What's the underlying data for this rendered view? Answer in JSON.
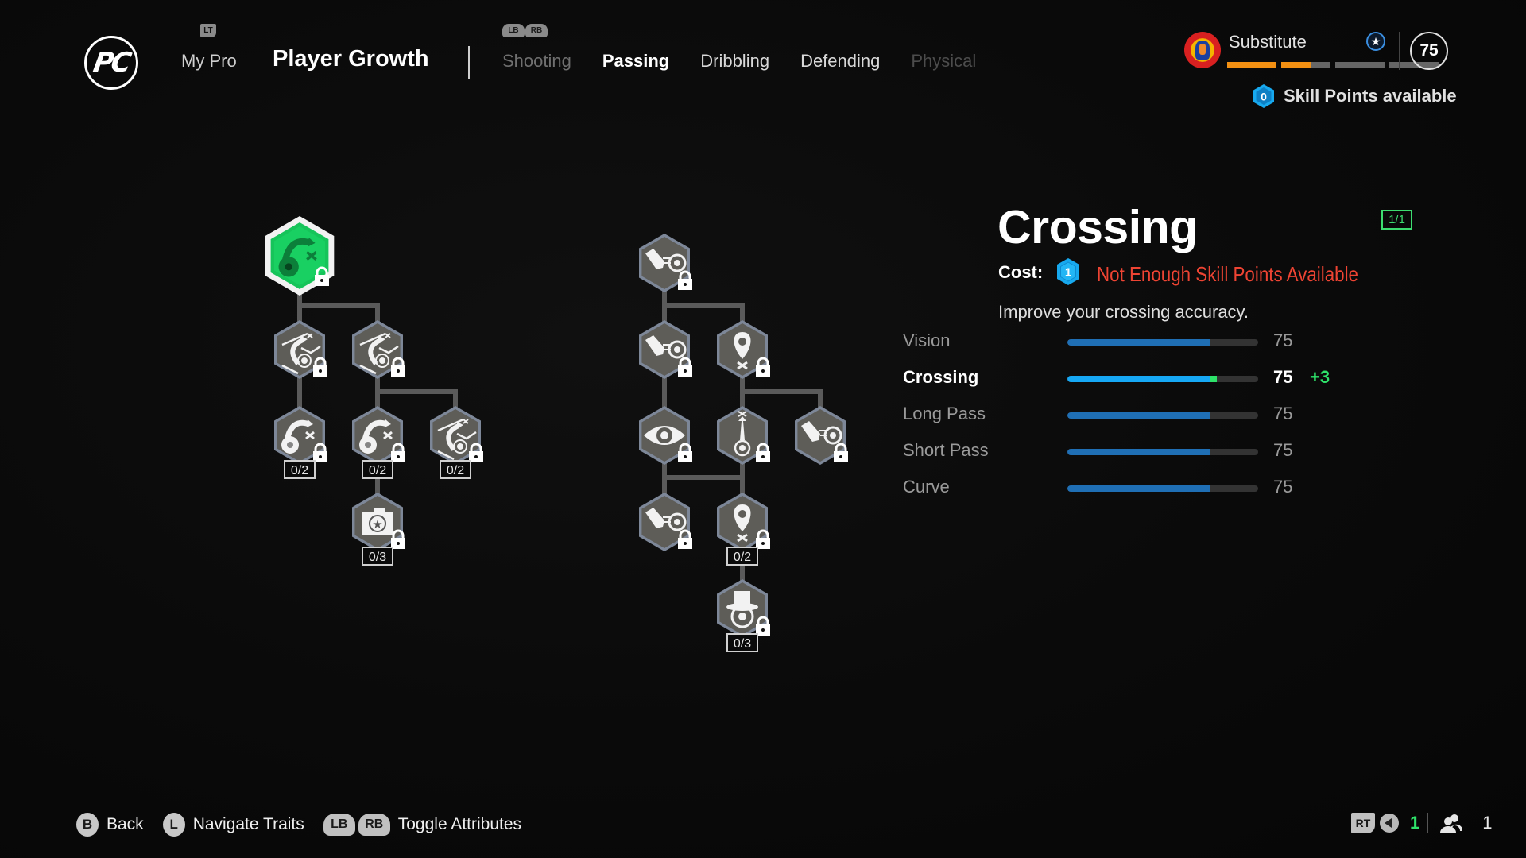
{
  "header": {
    "logo_text": "PC",
    "back_trigger": "LT",
    "my_pro_label": "My Pro",
    "title": "Player Growth",
    "tab_bumpers": [
      "LB",
      "RB"
    ],
    "tabs": [
      {
        "label": "Shooting",
        "state": "inactive"
      },
      {
        "label": "Passing",
        "state": "active"
      },
      {
        "label": "Dribbling",
        "state": "inactive"
      },
      {
        "label": "Defending",
        "state": "inactive"
      },
      {
        "label": "Physical",
        "state": "disabled"
      }
    ]
  },
  "player": {
    "club_crest": "East Bengal FC crest",
    "status": "Substitute",
    "status_icon": "star-icon",
    "form_segments": [
      1.0,
      0.6,
      0.0,
      0.0
    ],
    "overall_rating": "75",
    "skill_points": "0",
    "skill_points_label": "Skill Points available"
  },
  "tree": {
    "left": [
      {
        "id": "L1",
        "icon": "cross-ball-icon",
        "state": "selected",
        "count": null
      },
      {
        "id": "L2a",
        "icon": "cross-from-wing-icon",
        "state": "locked",
        "count": null
      },
      {
        "id": "L2b",
        "icon": "cross-from-wing-icon",
        "state": "locked",
        "count": null
      },
      {
        "id": "L3a",
        "icon": "cross-ball-icon",
        "state": "locked",
        "count": "0/2"
      },
      {
        "id": "L3b",
        "icon": "cross-ball-icon",
        "state": "locked",
        "count": "0/2"
      },
      {
        "id": "L3c",
        "icon": "cross-from-wing-icon",
        "state": "locked",
        "count": "0/2"
      },
      {
        "id": "L4",
        "icon": "camera-star-icon",
        "state": "locked",
        "count": "0/3"
      }
    ],
    "right": [
      {
        "id": "R1",
        "icon": "boot-kick-icon",
        "state": "locked",
        "count": null
      },
      {
        "id": "R2a",
        "icon": "boot-kick-icon",
        "state": "locked",
        "count": null
      },
      {
        "id": "R2b",
        "icon": "map-pin-target-icon",
        "state": "locked",
        "count": null
      },
      {
        "id": "R3a",
        "icon": "eye-icon",
        "state": "locked",
        "count": null
      },
      {
        "id": "R3b",
        "icon": "through-ball-icon",
        "state": "locked",
        "count": null
      },
      {
        "id": "R3c",
        "icon": "boot-kick-icon",
        "state": "locked",
        "count": null
      },
      {
        "id": "R4a",
        "icon": "boot-kick-icon",
        "state": "locked",
        "count": null
      },
      {
        "id": "R4b",
        "icon": "map-pin-target-icon",
        "state": "locked",
        "count": "0/2"
      },
      {
        "id": "R5",
        "icon": "top-hat-ball-icon",
        "state": "locked",
        "count": "0/3"
      }
    ]
  },
  "detail": {
    "title": "Crossing",
    "level": "1/1",
    "cost_label": "Cost:",
    "cost_value": "1",
    "warning": "Not Enough Skill Points Available",
    "description": "Improve your crossing accuracy.",
    "stats": [
      {
        "label": "Vision",
        "value": "75",
        "fraction": 0.75,
        "boost": null,
        "highlight": false
      },
      {
        "label": "Crossing",
        "value": "75",
        "fraction": 0.75,
        "boost": "+3",
        "boost_fraction": 0.03,
        "highlight": true
      },
      {
        "label": "Long Pass",
        "value": "75",
        "fraction": 0.75,
        "boost": null,
        "highlight": false
      },
      {
        "label": "Short Pass",
        "value": "75",
        "fraction": 0.75,
        "boost": null,
        "highlight": false
      },
      {
        "label": "Curve",
        "value": "75",
        "fraction": 0.75,
        "boost": null,
        "highlight": false
      }
    ]
  },
  "footer": {
    "actions": [
      {
        "glyph": "B",
        "label": "Back"
      },
      {
        "glyph": "L",
        "label": "Navigate Traits"
      },
      {
        "glyphs": [
          "LB",
          "RB"
        ],
        "label": "Toggle Attributes"
      }
    ],
    "right": {
      "trigger": "RT",
      "voice_count": "1",
      "party_count": "1"
    }
  },
  "colors": {
    "accent_green": "#2ee36a",
    "selected_node": "#16c45a",
    "stat_blue": "#1f6fb5",
    "stat_blue_highlight": "#16a8f5",
    "warning_red": "#ee4433",
    "form_orange": "#f39012",
    "skill_point_blue": "#17a9ef"
  }
}
